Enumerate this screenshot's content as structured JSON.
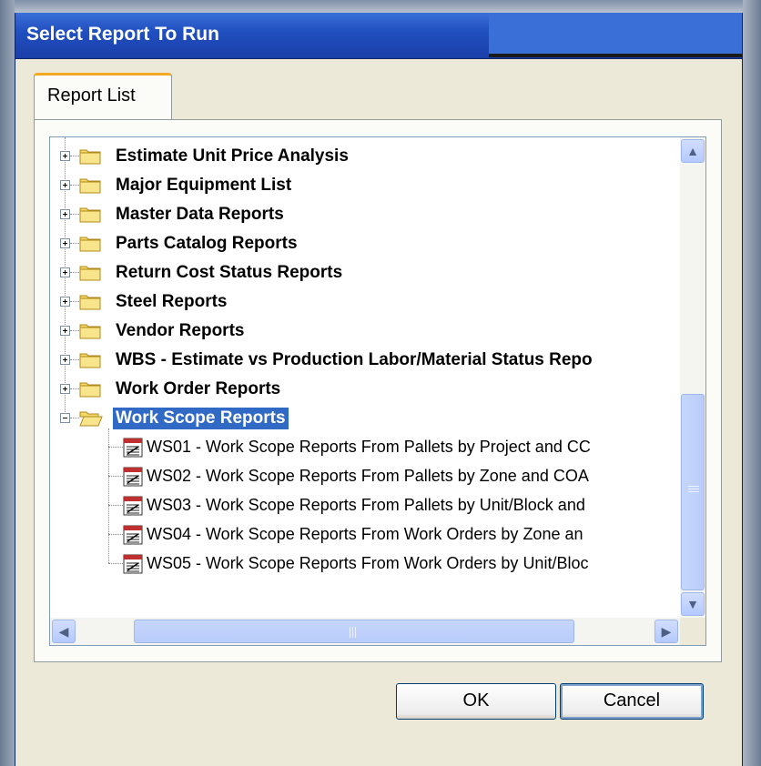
{
  "window": {
    "title": "Select Report To Run"
  },
  "tabs": [
    {
      "label": "Report List",
      "active": true
    }
  ],
  "tree": {
    "folders": [
      {
        "label": "Estimate Unit Price Analysis",
        "expanded": false
      },
      {
        "label": "Major Equipment List",
        "expanded": false
      },
      {
        "label": "Master Data Reports",
        "expanded": false
      },
      {
        "label": "Parts Catalog Reports",
        "expanded": false
      },
      {
        "label": "Return Cost Status Reports",
        "expanded": false
      },
      {
        "label": "Steel Reports",
        "expanded": false
      },
      {
        "label": "Vendor Reports",
        "expanded": false
      },
      {
        "label": "WBS - Estimate vs Production Labor/Material Status Repo",
        "expanded": false
      },
      {
        "label": "Work Order Reports",
        "expanded": false
      },
      {
        "label": "Work Scope Reports",
        "expanded": true,
        "selected": true
      }
    ],
    "reports": [
      {
        "label": "WS01 - Work Scope Reports From Pallets by Project and CC"
      },
      {
        "label": "WS02 - Work Scope Reports From Pallets by Zone and COA"
      },
      {
        "label": "WS03 - Work Scope Reports From Pallets by Unit/Block and"
      },
      {
        "label": "WS04 - Work Scope Reports From Work Orders by Zone an"
      },
      {
        "label": "WS05 - Work Scope Reports From Work Orders by Unit/Bloc"
      }
    ]
  },
  "buttons": {
    "ok": "OK",
    "cancel": "Cancel"
  },
  "colors": {
    "titlebar": "#2150c0",
    "selection": "#316ac5",
    "tab_accent": "#f5a821",
    "dialog_bg": "#ece9d8"
  },
  "icons": {
    "folder": "folder-icon",
    "report": "report-icon"
  }
}
